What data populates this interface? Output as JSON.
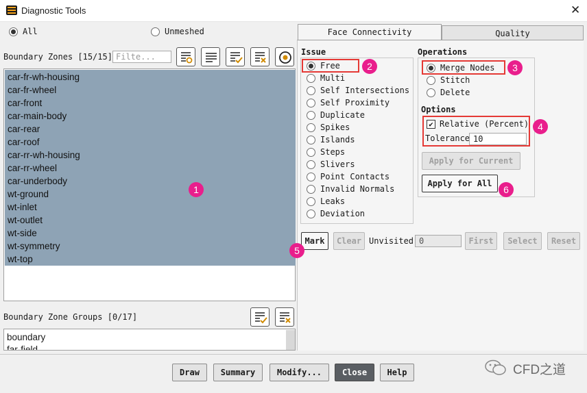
{
  "window": {
    "title": "Diagnostic Tools",
    "close_glyph": "✕"
  },
  "scope": {
    "all_label": "All",
    "unmeshed_label": "Unmeshed",
    "selected": "all"
  },
  "boundary_zones": {
    "label": "Boundary Zones [15/15]",
    "filter_placeholder": "Filter Text",
    "filter_visible": "Filte...",
    "toolbar_icons": [
      "select-visible-icon",
      "list-icon",
      "select-all-icon",
      "deselect-all-icon",
      "pick-icon"
    ],
    "items": [
      "car-fr-wh-housing",
      "car-fr-wheel",
      "car-front",
      "car-main-body",
      "car-rear",
      "car-roof",
      "car-rr-wh-housing",
      "car-rr-wheel",
      "car-underbody",
      "wt-ground",
      "wt-inlet",
      "wt-outlet",
      "wt-side",
      "wt-symmetry",
      "wt-top"
    ],
    "selection_color": "#8ea3b5"
  },
  "zone_groups": {
    "label": "Boundary Zone Groups [0/17]",
    "items": [
      "boundary",
      "far-field"
    ]
  },
  "tabs": {
    "face_connectivity": "Face Connectivity",
    "quality": "Quality",
    "active": "face_connectivity"
  },
  "issue": {
    "heading": "Issue",
    "options": [
      "Free",
      "Multi",
      "Self Intersections",
      "Self Proximity",
      "Duplicate",
      "Spikes",
      "Islands",
      "Steps",
      "Slivers",
      "Point Contacts",
      "Invalid Normals",
      "Leaks",
      "Deviation"
    ],
    "selected": "Free"
  },
  "operations": {
    "heading": "Operations",
    "options": [
      "Merge Nodes",
      "Stitch",
      "Delete"
    ],
    "selected": "Merge Nodes"
  },
  "options": {
    "heading": "Options",
    "relative_label": "Relative (Percent)",
    "relative_checked": true,
    "tolerance_label": "Tolerance",
    "tolerance_value": "10"
  },
  "apply": {
    "current": "Apply for Current",
    "all": "Apply for All"
  },
  "mark_row": {
    "mark": "Mark",
    "clear": "Clear",
    "unvisited_label": "Unvisited",
    "unvisited_value": "0",
    "first": "First",
    "select": "Select",
    "reset": "Reset"
  },
  "footer": {
    "draw": "Draw",
    "summary": "Summary",
    "modify": "Modify...",
    "close": "Close",
    "help": "Help"
  },
  "annotations": [
    "1",
    "2",
    "3",
    "4",
    "5",
    "6"
  ],
  "watermark": {
    "text": "CFD之道"
  },
  "colors": {
    "highlight": "#e53935",
    "badge": "#e91e8c",
    "close_button": "#5a5e63"
  }
}
